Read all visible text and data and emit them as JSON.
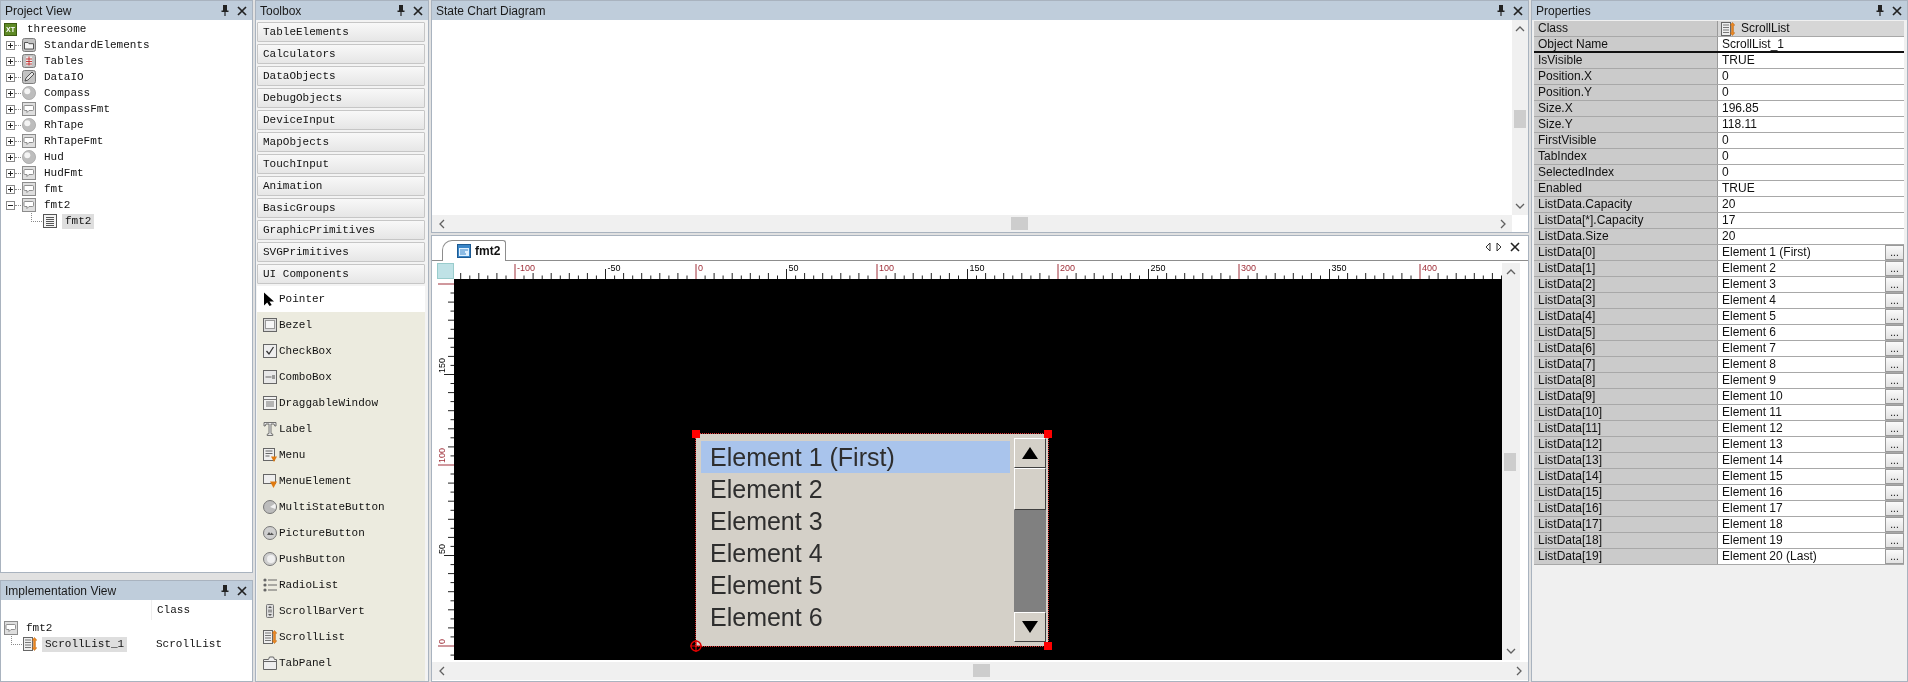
{
  "project_view": {
    "title": "Project View",
    "root": {
      "badge": "XT",
      "label": "threesome",
      "selected": false,
      "children": [
        {
          "label": "StandardElements",
          "kind": "folder",
          "expanded": false,
          "selected": false
        },
        {
          "label": "Tables",
          "kind": "table",
          "expanded": false,
          "selected": false
        },
        {
          "label": "DataIO",
          "kind": "io",
          "expanded": false,
          "selected": false
        },
        {
          "label": "Compass",
          "kind": "sphere",
          "expanded": false,
          "selected": false
        },
        {
          "label": "CompassFmt",
          "kind": "format",
          "expanded": false,
          "selected": false
        },
        {
          "label": "RhTape",
          "kind": "sphere",
          "expanded": false,
          "selected": false
        },
        {
          "label": "RhTapeFmt",
          "kind": "format",
          "expanded": false,
          "selected": false
        },
        {
          "label": "Hud",
          "kind": "sphere",
          "expanded": false,
          "selected": false
        },
        {
          "label": "HudFmt",
          "kind": "format",
          "expanded": false,
          "selected": false
        },
        {
          "label": "fmt",
          "kind": "format",
          "expanded": false,
          "selected": false
        },
        {
          "label": "fmt2",
          "kind": "format",
          "expanded": true,
          "selected": false,
          "children": [
            {
              "label": "fmt2",
              "kind": "page",
              "selected": true
            }
          ]
        }
      ]
    }
  },
  "implementation_view": {
    "title": "Implementation View",
    "class_header": "Class",
    "root": {
      "label": "fmt2",
      "kind": "format",
      "selected": false,
      "children": [
        {
          "label": "ScrollList_1",
          "class": "ScrollList",
          "kind": "scrolllist",
          "selected": true
        }
      ]
    }
  },
  "toolbox": {
    "title": "Toolbox",
    "categories": [
      {
        "label": "TableElements"
      },
      {
        "label": "Calculators"
      },
      {
        "label": "DataObjects"
      },
      {
        "label": "DebugObjects"
      },
      {
        "label": "DeviceInput"
      },
      {
        "label": "MapObjects"
      },
      {
        "label": "TouchInput"
      },
      {
        "label": "Animation"
      },
      {
        "label": "BasicGroups"
      },
      {
        "label": "GraphicPrimitives"
      },
      {
        "label": "SVGPrimitives"
      },
      {
        "label": "UI Components",
        "items": [
          {
            "label": "Pointer",
            "kind": "pointer",
            "selected": true
          },
          {
            "label": "Bezel",
            "kind": "bezel",
            "selected": false
          },
          {
            "label": "CheckBox",
            "kind": "checkbox",
            "selected": false
          },
          {
            "label": "ComboBox",
            "kind": "combobox",
            "selected": false
          },
          {
            "label": "DraggableWindow",
            "kind": "window",
            "selected": false
          },
          {
            "label": "Label",
            "kind": "label",
            "selected": false
          },
          {
            "label": "Menu",
            "kind": "menu",
            "selected": false
          },
          {
            "label": "MenuElement",
            "kind": "menuitem",
            "selected": false
          },
          {
            "label": "MultiStateButton",
            "kind": "multistate",
            "selected": false
          },
          {
            "label": "PictureButton",
            "kind": "picture",
            "selected": false
          },
          {
            "label": "PushButton",
            "kind": "push",
            "selected": false
          },
          {
            "label": "RadioList",
            "kind": "radiolist",
            "selected": false
          },
          {
            "label": "ScrollBarVert",
            "kind": "scrollbar",
            "selected": false
          },
          {
            "label": "ScrollList",
            "kind": "scrolllist",
            "selected": false
          },
          {
            "label": "TabPanel",
            "kind": "tabpanel",
            "selected": false
          }
        ]
      }
    ]
  },
  "state_chart": {
    "title": "State Chart Diagram"
  },
  "editor": {
    "tab": {
      "label": "fmt2",
      "selected": true
    },
    "ruler_top": [
      {
        "label": "-100",
        "kind": "major"
      },
      {
        "label": "-50",
        "kind": "minor"
      },
      {
        "label": "0",
        "kind": "major"
      },
      {
        "label": "50",
        "kind": "minor"
      },
      {
        "label": "100",
        "kind": "major"
      },
      {
        "label": "150",
        "kind": "minor"
      },
      {
        "label": "200",
        "kind": "major"
      },
      {
        "label": "250",
        "kind": "minor"
      },
      {
        "label": "300",
        "kind": "major"
      },
      {
        "label": "350",
        "kind": "minor"
      },
      {
        "label": "400",
        "kind": "major"
      }
    ],
    "ruler_left": [
      {
        "label": "150",
        "kind": "minor"
      },
      {
        "label": "100",
        "kind": "major"
      },
      {
        "label": "50",
        "kind": "minor"
      },
      {
        "label": "0",
        "kind": "major"
      }
    ],
    "scroll_list": {
      "items": [
        {
          "label": "Element 1 (First)",
          "selected": true
        },
        {
          "label": "Element 2",
          "selected": false
        },
        {
          "label": "Element 3",
          "selected": false
        },
        {
          "label": "Element 4",
          "selected": false
        },
        {
          "label": "Element 5",
          "selected": false
        },
        {
          "label": "Element 6",
          "selected": false
        }
      ]
    }
  },
  "properties": {
    "title": "Properties",
    "rows": [
      {
        "name": "Class",
        "value": "ScrollList",
        "kind": "class"
      },
      {
        "name": "Object Name",
        "value": "ScrollList_1",
        "kind": "edit"
      },
      {
        "name": "IsVisible",
        "value": "TRUE",
        "kind": "plain"
      },
      {
        "name": "Position.X",
        "value": "0",
        "kind": "plain"
      },
      {
        "name": "Position.Y",
        "value": "0",
        "kind": "plain"
      },
      {
        "name": "Size.X",
        "value": "196.85",
        "kind": "plain"
      },
      {
        "name": "Size.Y",
        "value": "118.11",
        "kind": "plain"
      },
      {
        "name": "FirstVisible",
        "value": "0",
        "kind": "plain"
      },
      {
        "name": "TabIndex",
        "value": "0",
        "kind": "plain"
      },
      {
        "name": "SelectedIndex",
        "value": "0",
        "kind": "plain"
      },
      {
        "name": "Enabled",
        "value": "TRUE",
        "kind": "plain"
      },
      {
        "name": "ListData.Capacity",
        "value": "20",
        "kind": "plain"
      },
      {
        "name": "ListData[*].Capacity",
        "value": "17",
        "kind": "plain"
      },
      {
        "name": "ListData.Size",
        "value": "20",
        "kind": "plain"
      },
      {
        "name": "ListData[0]",
        "value": "Element 1 (First)",
        "kind": "item",
        "button": "..."
      },
      {
        "name": "ListData[1]",
        "value": "Element 2",
        "kind": "item",
        "button": "..."
      },
      {
        "name": "ListData[2]",
        "value": "Element 3",
        "kind": "item",
        "button": "..."
      },
      {
        "name": "ListData[3]",
        "value": "Element 4",
        "kind": "item",
        "button": "..."
      },
      {
        "name": "ListData[4]",
        "value": "Element 5",
        "kind": "item",
        "button": "..."
      },
      {
        "name": "ListData[5]",
        "value": "Element 6",
        "kind": "item",
        "button": "..."
      },
      {
        "name": "ListData[6]",
        "value": "Element 7",
        "kind": "item",
        "button": "..."
      },
      {
        "name": "ListData[7]",
        "value": "Element 8",
        "kind": "item",
        "button": "..."
      },
      {
        "name": "ListData[8]",
        "value": "Element 9",
        "kind": "item",
        "button": "..."
      },
      {
        "name": "ListData[9]",
        "value": "Element 10",
        "kind": "item",
        "button": "..."
      },
      {
        "name": "ListData[10]",
        "value": "Element 11",
        "kind": "item",
        "button": "..."
      },
      {
        "name": "ListData[11]",
        "value": "Element 12",
        "kind": "item",
        "button": "..."
      },
      {
        "name": "ListData[12]",
        "value": "Element 13",
        "kind": "item",
        "button": "..."
      },
      {
        "name": "ListData[13]",
        "value": "Element 14",
        "kind": "item",
        "button": "..."
      },
      {
        "name": "ListData[14]",
        "value": "Element 15",
        "kind": "item",
        "button": "..."
      },
      {
        "name": "ListData[15]",
        "value": "Element 16",
        "kind": "item",
        "button": "..."
      },
      {
        "name": "ListData[16]",
        "value": "Element 17",
        "kind": "item",
        "button": "..."
      },
      {
        "name": "ListData[17]",
        "value": "Element 18",
        "kind": "item",
        "button": "..."
      },
      {
        "name": "ListData[18]",
        "value": "Element 19",
        "kind": "item",
        "button": "..."
      },
      {
        "name": "ListData[19]",
        "value": "Element 20 (Last)",
        "kind": "item",
        "button": "..."
      }
    ]
  }
}
